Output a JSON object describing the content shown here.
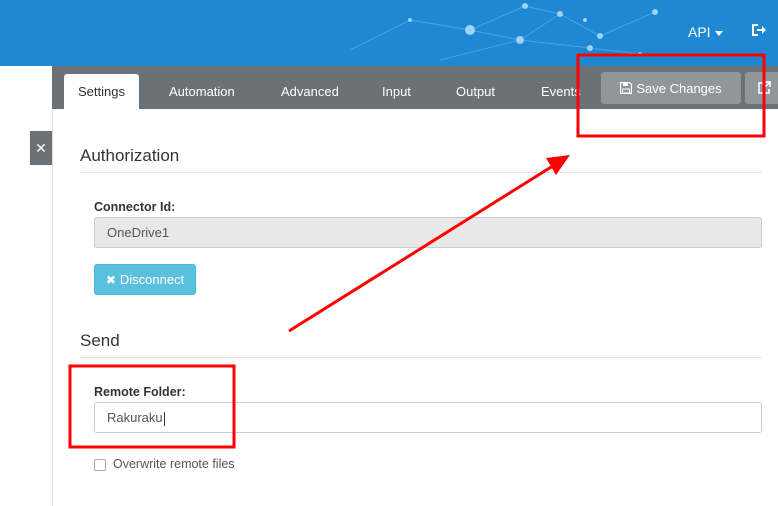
{
  "header": {
    "api_label": "API"
  },
  "tabs": [
    {
      "label": "Settings"
    },
    {
      "label": "Automation"
    },
    {
      "label": "Advanced"
    },
    {
      "label": "Input"
    },
    {
      "label": "Output"
    },
    {
      "label": "Events"
    }
  ],
  "toolbar": {
    "save_label": "Save Changes"
  },
  "authorization": {
    "title": "Authorization",
    "connector_label": "Connector Id:",
    "connector_value": "OneDrive1",
    "disconnect_label": "Disconnect"
  },
  "send": {
    "title": "Send",
    "remote_folder_label": "Remote Folder:",
    "remote_folder_value": "Rakuraku",
    "overwrite_label": "Overwrite remote files",
    "overwrite_checked": false
  },
  "colors": {
    "header_bg": "#1e88d3",
    "tabbar_bg": "#6b7277",
    "button_gray": "#8f979c",
    "info_button": "#5bc0de",
    "annotation_red": "#ff0000"
  },
  "icons": {
    "api_caret": "caret-down-icon",
    "logout": "sign-out-icon",
    "save": "floppy-disk-icon",
    "popout": "external-link-icon",
    "close": "close-icon",
    "disconnect": "times-icon"
  }
}
